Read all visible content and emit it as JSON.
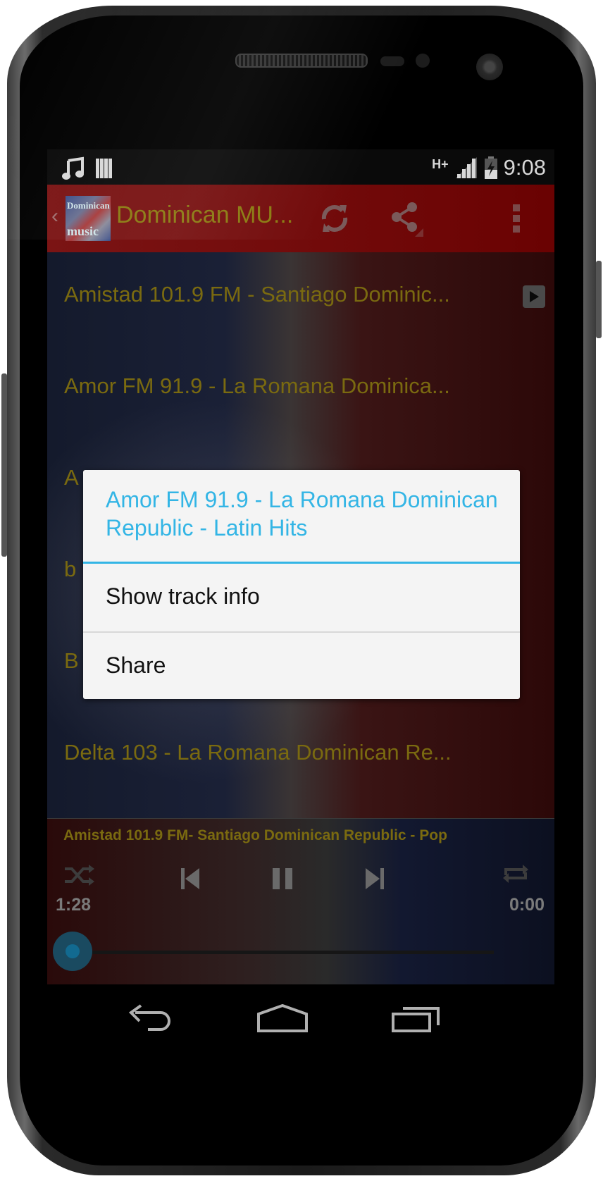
{
  "status_bar": {
    "notification_icons": [
      "music-note-icon",
      "barcode-icon"
    ],
    "network": "H+",
    "time": "9:08"
  },
  "action_bar": {
    "logo_text_top": "Dominican",
    "logo_text_bottom": "music",
    "title": "Dominican MU...",
    "actions": [
      "refresh-icon",
      "share-icon",
      "overflow-menu-icon"
    ]
  },
  "stations": [
    {
      "label": "Amistad 101.9 FM - Santiago Dominic...",
      "has_play_button": true
    },
    {
      "label": "Amor FM 91.9 - La Romana Dominica...",
      "has_play_button": false
    },
    {
      "label": "A",
      "has_play_button": false
    },
    {
      "label": "b",
      "has_play_button": false
    },
    {
      "label": "B",
      "has_play_button": false
    },
    {
      "label": "Delta 103 - La Romana Dominican Re...",
      "has_play_button": false
    }
  ],
  "player": {
    "now_playing": "Amistad 101.9 FM-  Santiago Dominican Republic   -  Pop",
    "elapsed": "1:28",
    "duration": "0:00",
    "progress": 0,
    "controls": [
      "shuffle-icon",
      "previous-icon",
      "pause-icon",
      "next-icon",
      "repeat-icon"
    ]
  },
  "context_menu": {
    "title": "Amor FM 91.9 - La Romana Dominican Republic  - Latin Hits",
    "items": [
      "Show track info",
      "Share"
    ]
  },
  "navigation": [
    "back",
    "home",
    "recent-apps"
  ],
  "colors": {
    "accent": "#33b5e5",
    "action_bar": "#6a0202",
    "list_text": "#7a6a10"
  }
}
